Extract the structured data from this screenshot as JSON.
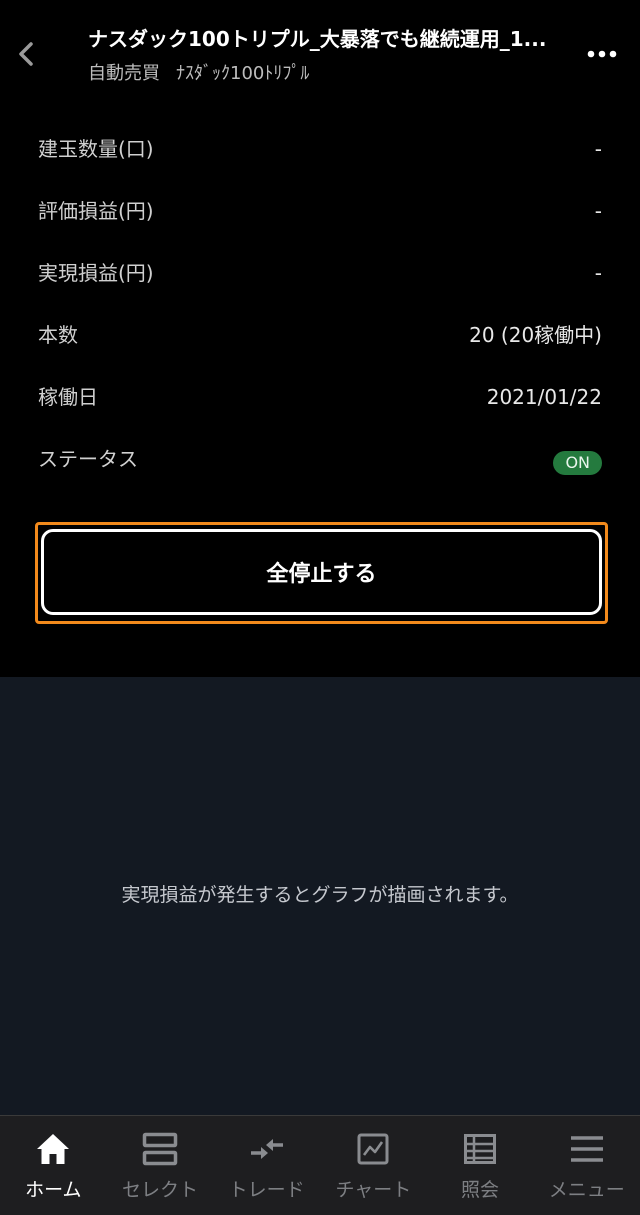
{
  "header": {
    "title": "ナスダック100トリプル_大暴落でも継続運用_1...",
    "subtitle_category": "自動売買",
    "subtitle_name": "ﾅｽﾀﾞｯｸ100ﾄﾘﾌﾟﾙ"
  },
  "details": [
    {
      "label": "建玉数量(口)",
      "value": "-"
    },
    {
      "label": "評価損益(円)",
      "value": "-"
    },
    {
      "label": "実現損益(円)",
      "value": "-"
    },
    {
      "label": "本数",
      "value": "20 (20稼働中)"
    },
    {
      "label": "稼働日",
      "value": "2021/01/22"
    },
    {
      "label": "ステータス",
      "value": "ON"
    }
  ],
  "stop_button": {
    "label": "全停止する"
  },
  "graph": {
    "empty_message": "実現損益が発生するとグラフが描画されます。"
  },
  "bottom_nav": [
    {
      "label": "ホーム",
      "icon": "home-icon",
      "active": true
    },
    {
      "label": "セレクト",
      "icon": "select-icon",
      "active": false
    },
    {
      "label": "トレード",
      "icon": "trade-arrows-icon",
      "active": false
    },
    {
      "label": "チャート",
      "icon": "chart-icon",
      "active": false
    },
    {
      "label": "照会",
      "icon": "inquiry-list-icon",
      "active": false
    },
    {
      "label": "メニュー",
      "icon": "menu-icon",
      "active": false
    }
  ],
  "colors": {
    "accent_focus": "#f28a1c",
    "status_on": "#247a3e",
    "nav_active": "#ffffff",
    "nav_inactive": "#7d7f83"
  }
}
